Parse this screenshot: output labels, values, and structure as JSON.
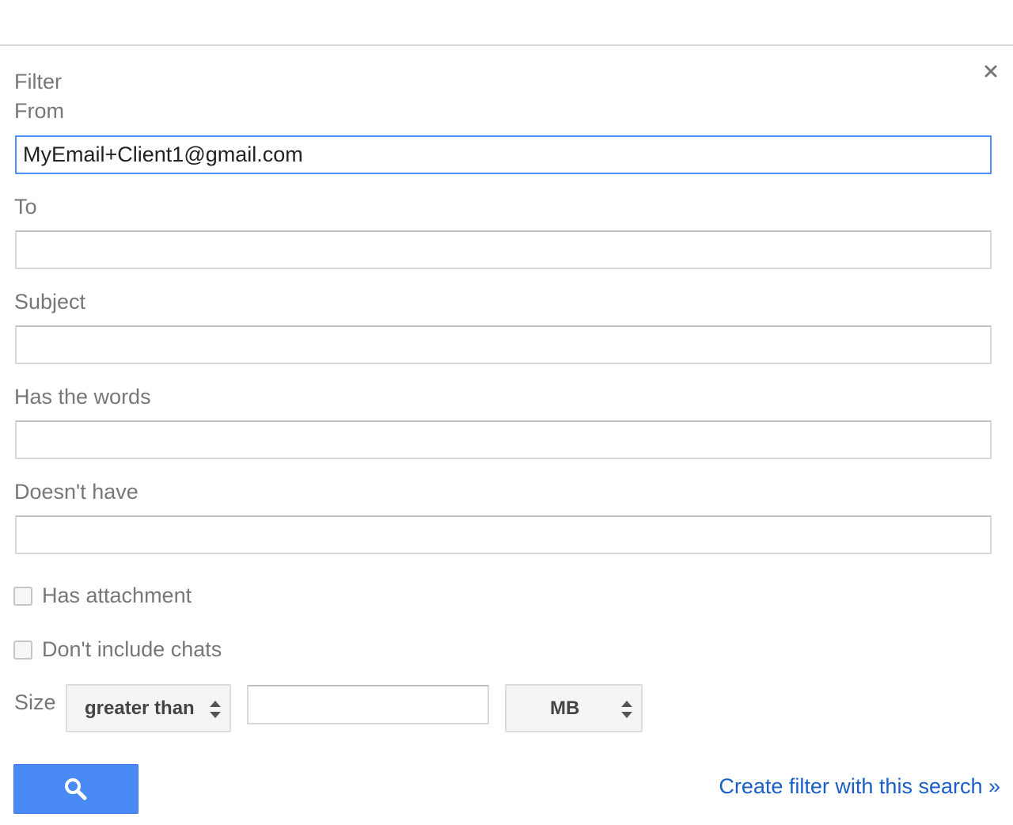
{
  "dialog": {
    "title": "Filter",
    "close_symbol": "×",
    "icons": {
      "close": "close-icon",
      "search": "search-icon",
      "select_arrows": "up-down-arrows-icon"
    }
  },
  "fields": {
    "from": {
      "label": "From",
      "value": "MyEmail+Client1@gmail.com"
    },
    "to": {
      "label": "To",
      "value": ""
    },
    "subject": {
      "label": "Subject",
      "value": ""
    },
    "has_words": {
      "label": "Has the words",
      "value": ""
    },
    "doesnt_have": {
      "label": "Doesn't have",
      "value": ""
    }
  },
  "checkboxes": {
    "has_attachment": {
      "label": "Has attachment",
      "checked": false
    },
    "dont_include_chats": {
      "label": "Don't include chats",
      "checked": false
    }
  },
  "size": {
    "label": "Size",
    "comparison": "greater than",
    "value": "",
    "unit": "MB"
  },
  "actions": {
    "create_filter_label": "Create filter with this search »"
  },
  "colors": {
    "accent_blue": "#4a8af4",
    "focus_border": "#4d90fe",
    "link_blue": "#1a5fc7"
  }
}
